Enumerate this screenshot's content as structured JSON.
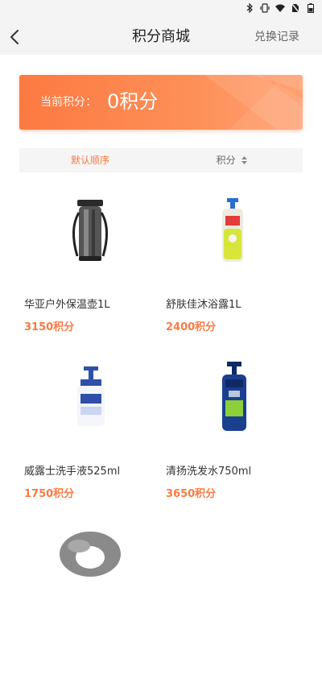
{
  "status_icons": [
    "bluetooth-icon",
    "vibrate-icon",
    "wifi-icon",
    "no-sim-icon",
    "battery-icon"
  ],
  "header": {
    "title": "积分商城",
    "right_action": "兑换记录",
    "back_icon": "chevron-left-icon"
  },
  "points_card": {
    "label": "当前积分：",
    "value": "0积分"
  },
  "sort_bar": {
    "default_label": "默认顺序",
    "points_label": "积分"
  },
  "products": [
    {
      "name": "华亚户外保温壶1L",
      "price": "3150积分",
      "icon": "thermos-icon"
    },
    {
      "name": "舒肤佳沐浴露1L",
      "price": "2400积分",
      "icon": "body-wash-icon"
    },
    {
      "name": "威露士洗手液525ml",
      "price": "1750积分",
      "icon": "hand-soap-icon"
    },
    {
      "name": "清扬洗发水750ml",
      "price": "3650积分",
      "icon": "shampoo-icon"
    },
    {
      "name": "",
      "price": "",
      "icon": "neck-pillow-icon"
    }
  ],
  "colors": {
    "accent": "#fc7a42",
    "background": "#ffffff",
    "bar": "#f4f4f4"
  }
}
